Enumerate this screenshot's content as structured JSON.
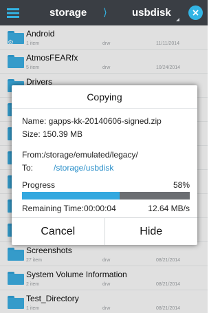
{
  "topbar": {
    "breadcrumb_first": "storage",
    "breadcrumb_sep": "⟩",
    "breadcrumb_second": "usbdisk",
    "accent": "#33b5e5"
  },
  "files": [
    {
      "name": "Android",
      "count": "1 item",
      "perm": "drw",
      "date": "11/11/2014",
      "icon": "folder-gear-icon"
    },
    {
      "name": "AtmosFEARfx",
      "count": "5 item",
      "perm": "drw",
      "date": "10/24/2014",
      "icon": "folder-icon"
    },
    {
      "name": "Drivers",
      "count": "",
      "perm": "",
      "date": "",
      "icon": "folder-icon"
    },
    {
      "name": "",
      "count": "",
      "perm": "",
      "date": "",
      "icon": "folder-icon"
    },
    {
      "name": "",
      "count": "",
      "perm": "",
      "date": "",
      "icon": "folder-icon"
    },
    {
      "name": "",
      "count": "",
      "perm": "",
      "date": "",
      "icon": "folder-icon"
    },
    {
      "name": "",
      "count": "",
      "perm": "",
      "date": "",
      "icon": "folder-icon"
    },
    {
      "name": "",
      "count": "",
      "perm": "",
      "date": "",
      "icon": "folder-icon"
    },
    {
      "name": "",
      "count": "",
      "perm": "",
      "date": "",
      "icon": "folder-icon"
    },
    {
      "name": "Screenshots",
      "count": "27 item",
      "perm": "drw",
      "date": "08/21/2014",
      "icon": "folder-icon"
    },
    {
      "name": "System Volume Information",
      "count": "2 item",
      "perm": "drw",
      "date": "08/21/2014",
      "icon": "folder-icon"
    },
    {
      "name": "Test_Directory",
      "count": "1 item",
      "perm": "drw",
      "date": "08/21/2014",
      "icon": "folder-icon"
    }
  ],
  "dialog": {
    "title": "Copying",
    "name_line": "Name: gapps-kk-20140606-signed.zip",
    "size_line": "Size: 150.39 MB",
    "from_line": "From:/storage/emulated/legacy/",
    "to_label": "To:",
    "to_path": "/storage/usbdisk",
    "progress_label": "Progress",
    "progress_percent": 58,
    "progress_text": "58%",
    "remaining": "Remaining Time:00:00:04",
    "speed": "12.64 MB/s",
    "cancel_label": "Cancel",
    "hide_label": "Hide"
  }
}
